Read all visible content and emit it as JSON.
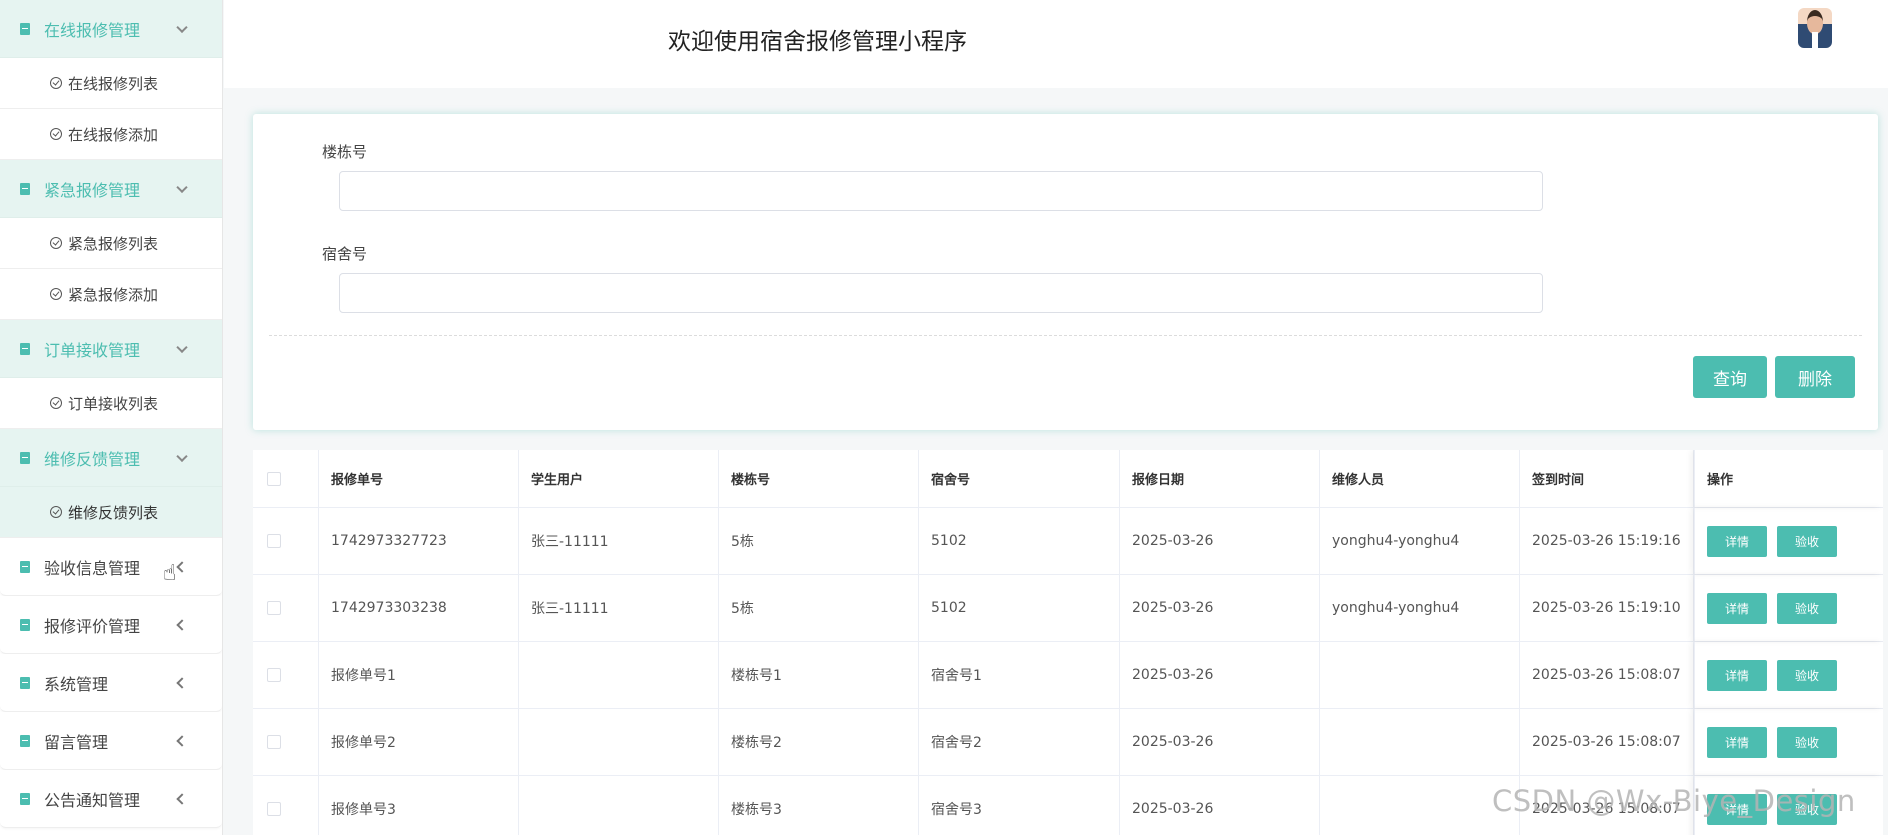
{
  "sidebar": {
    "groups": [
      {
        "label": "在线报修管理",
        "sub": [
          "在线报修列表",
          "在线报修添加"
        ]
      },
      {
        "label": "紧急报修管理",
        "sub": [
          "紧急报修列表",
          "紧急报修添加"
        ]
      },
      {
        "label": "订单接收管理",
        "sub": [
          "订单接收列表"
        ]
      },
      {
        "label": "维修反馈管理",
        "sub": [
          "维修反馈列表"
        ]
      },
      {
        "label": "验收信息管理"
      },
      {
        "label": "报修评价管理"
      },
      {
        "label": "系统管理"
      },
      {
        "label": "留言管理"
      },
      {
        "label": "公告通知管理"
      }
    ]
  },
  "header": {
    "title": "欢迎使用宿舍报修管理小程序"
  },
  "search": {
    "building_label": "楼栋号",
    "building_value": "",
    "dorm_label": "宿舍号",
    "dorm_value": "",
    "query_button": "查询",
    "delete_button": "删除"
  },
  "table": {
    "columns": [
      "报修单号",
      "学生用户",
      "楼栋号",
      "宿舍号",
      "报修日期",
      "维修人员",
      "签到时间",
      "操作"
    ],
    "detail_label": "详情",
    "accept_label": "验收",
    "rows": [
      [
        "1742973327723",
        "张三-11111",
        "5栋",
        "5102",
        "2025-03-26",
        "yonghu4-yonghu4",
        "2025-03-26 15:19:16"
      ],
      [
        "1742973303238",
        "张三-11111",
        "5栋",
        "5102",
        "2025-03-26",
        "yonghu4-yonghu4",
        "2025-03-26 15:19:10"
      ],
      [
        "报修单号1",
        "",
        "楼栋号1",
        "宿舍号1",
        "2025-03-26",
        "",
        "2025-03-26 15:08:07"
      ],
      [
        "报修单号2",
        "",
        "楼栋号2",
        "宿舍号2",
        "2025-03-26",
        "",
        "2025-03-26 15:08:07"
      ],
      [
        "报修单号3",
        "",
        "楼栋号3",
        "宿舍号3",
        "2025-03-26",
        "",
        "2025-03-26 15:08:07"
      ]
    ]
  },
  "watermark": "CSDN @Wx-Biye_Design",
  "colors": {
    "accent": "#4cbdb0",
    "active_bg": "#e6f4f1"
  },
  "icons": [
    "document-icon",
    "check-circle-icon",
    "chevron-down-icon",
    "chevron-left-icon",
    "avatar",
    "hand-cursor-icon"
  ]
}
